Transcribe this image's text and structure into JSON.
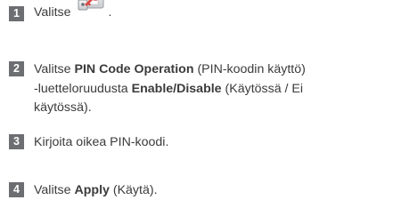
{
  "steps": [
    {
      "number": "1",
      "text": "Valitse",
      "icon": "pin-lock-settings-icon",
      "after_icon": "."
    },
    {
      "number": "2",
      "line1_a": "Valitse ",
      "line1_bold": "PIN Code Operation",
      "line1_b": " (PIN-koodin käyttö)",
      "line2_a": "-luetteloruudusta ",
      "line2_bold": "Enable/Disable",
      "line2_b": " (Käytössä / Ei",
      "line3": "käytössä)."
    },
    {
      "number": "3",
      "text": "Kirjoita oikea PIN-koodi."
    },
    {
      "number": "4",
      "text_a": "Valitse ",
      "bold": "Apply",
      "text_b": " (Käytä)."
    }
  ],
  "colors": {
    "number_badge": "#6d6e71",
    "text": "#3b3b3b",
    "icon_red": "#d7322f"
  }
}
